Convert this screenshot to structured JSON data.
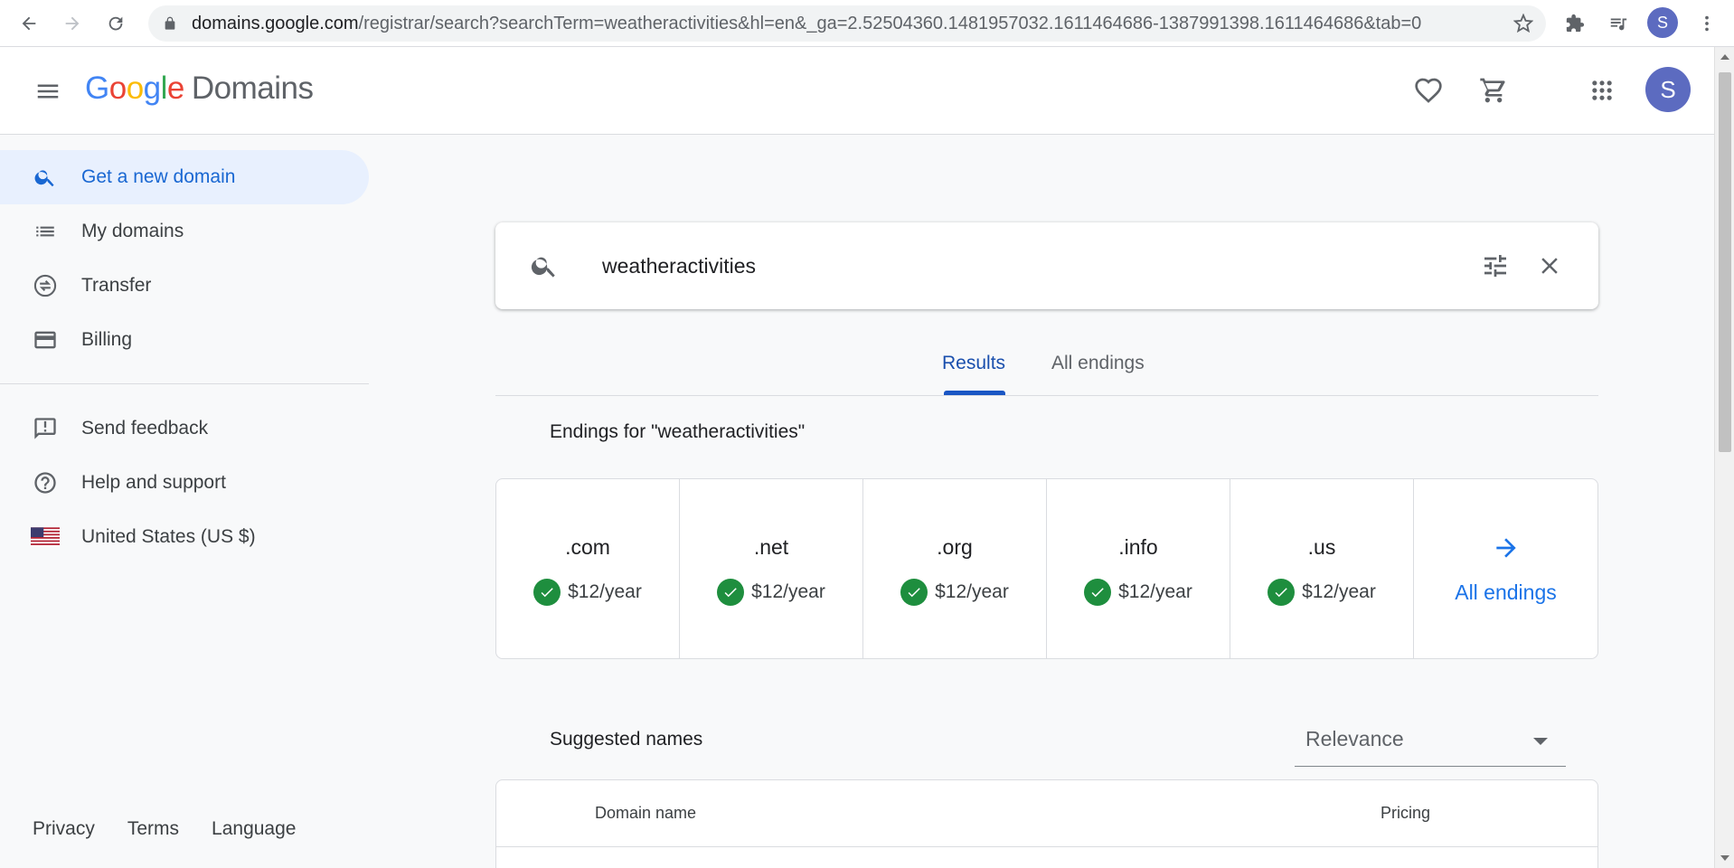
{
  "browser": {
    "url_host": "domains.google.com",
    "url_path": "/registrar/search?searchTerm=weatheractivities&hl=en&_ga=2.52504360.1481957032.1611464686-1387991398.1611464686&tab=0",
    "profile_initial": "S"
  },
  "header": {
    "logo_letters": [
      "G",
      "o",
      "o",
      "g",
      "l",
      "e"
    ],
    "product": "Domains",
    "user_initial": "S"
  },
  "sidebar": {
    "items": [
      {
        "label": "Get a new domain",
        "icon": "search-icon",
        "active": true
      },
      {
        "label": "My domains",
        "icon": "list-icon"
      },
      {
        "label": "Transfer",
        "icon": "transfer-icon"
      },
      {
        "label": "Billing",
        "icon": "credit-card-icon"
      },
      {
        "label": "Send feedback",
        "icon": "feedback-icon"
      },
      {
        "label": "Help and support",
        "icon": "help-icon"
      },
      {
        "label": "United States (US $)",
        "icon": "us-flag-icon"
      }
    ],
    "footer": [
      "Privacy",
      "Terms",
      "Language"
    ]
  },
  "search": {
    "query": "weatheractivities"
  },
  "tabs": [
    "Results",
    "All endings"
  ],
  "endings": {
    "title": "Endings for \"weatheractivities\"",
    "items": [
      {
        "tld": ".com",
        "price": "$12/year"
      },
      {
        "tld": ".net",
        "price": "$12/year"
      },
      {
        "tld": ".org",
        "price": "$12/year"
      },
      {
        "tld": ".info",
        "price": "$12/year"
      },
      {
        "tld": ".us",
        "price": "$12/year"
      }
    ],
    "all_label": "All endings"
  },
  "suggested": {
    "title": "Suggested names",
    "sort_value": "Relevance",
    "columns": [
      "Domain name",
      "Pricing"
    ]
  },
  "colors": {
    "accent": "#1a73e8",
    "active_nav_bg": "#e8f0fe",
    "available_check": "#1e8e3e",
    "avatar": "#5c6bc0"
  }
}
